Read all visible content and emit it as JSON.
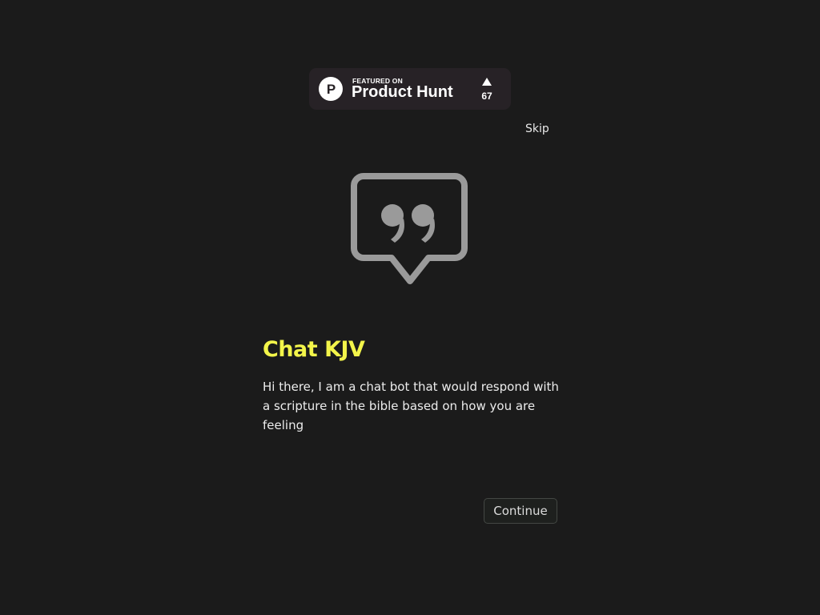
{
  "badge": {
    "small_text": "FEATURED ON",
    "brand_text": "Product Hunt",
    "logo_letter": "P",
    "upvote_count": "67",
    "upvote_icon": "triangle-up-icon",
    "background_color": "#272226"
  },
  "skip": {
    "label": "Skip"
  },
  "hero": {
    "icon": "quote-bubble-icon",
    "icon_color": "#9a9a9a"
  },
  "intro": {
    "title": "Chat KJV",
    "title_color": "#f3f54a",
    "description": "Hi there, I am a chat bot that would respond with a scripture in the bible based on how you are feeling"
  },
  "actions": {
    "continue_label": "Continue"
  },
  "theme": {
    "background": "#1b1b1b"
  }
}
